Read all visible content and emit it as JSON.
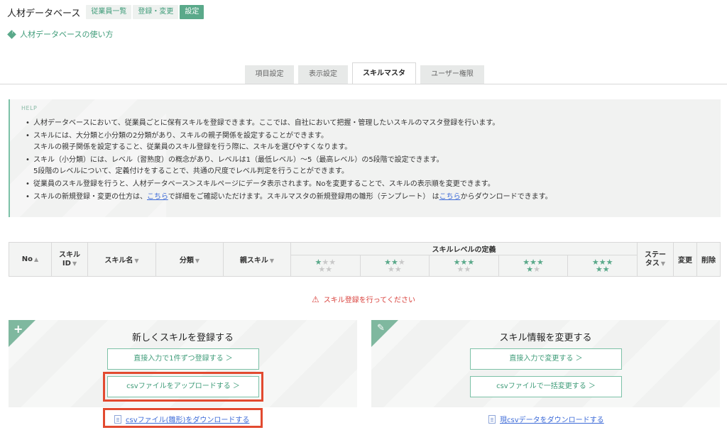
{
  "header": {
    "app_title": "人材データベース",
    "nav": [
      {
        "label": "従業員一覧"
      },
      {
        "label": "登録・変更"
      },
      {
        "label": "設定"
      }
    ]
  },
  "howto_link": "人材データベースの使い方",
  "tabs": [
    {
      "label": "項目設定"
    },
    {
      "label": "表示設定"
    },
    {
      "label": "スキルマスタ"
    },
    {
      "label": "ユーザー権限"
    }
  ],
  "help": {
    "label": "HELP",
    "items": [
      {
        "line1": "人材データベースにおいて、従業員ごとに保有スキルを登録できます。ここでは、自社において把握・管理したいスキルのマスタ登録を行います。"
      },
      {
        "line1": "スキルには、大分類と小分類の2分類があり、スキルの親子関係を設定することができます。",
        "line2": "スキルの親子関係を設定すること、従業員のスキル登録を行う際に、スキルを選びやすくなります。"
      },
      {
        "line1": "スキル（小分類）には、レベル（習熟度）の概念があり、レベルは1（最低レベル）〜5（最高レベル）の5段階で設定できます。",
        "line2": "5段階のレベルについて、定義付けをすることで、共通の尺度でレベル判定を行うことができます。"
      },
      {
        "line1": "従業員のスキル登録を行うと、人材データベース＞スキルページにデータ表示されます。Noを変更することで、スキルの表示順を変更できます。"
      },
      {
        "pre": "スキルの新規登録・変更の仕方は、",
        "link1": "こちら",
        "mid": "で詳細をご確認いただけます。スキルマスタの新規登録用の雛形（テンプレート） は",
        "link2": "こちら",
        "post": "からダウンロードできます。"
      }
    ]
  },
  "table": {
    "col_no": "No",
    "col_skill_id_1": "スキル",
    "col_skill_id_2": "ID",
    "col_skill_name": "スキル名",
    "col_category": "分類",
    "col_parent": "親スキル",
    "col_levels": "スキルレベルの定義",
    "col_status_1": "ステー",
    "col_status_2": "タス",
    "col_edit": "変更",
    "col_delete": "削除",
    "sort_up": "▲",
    "sort_down": "▼",
    "levels": [
      {
        "value": 1,
        "top": "★★★",
        "bottom": "★★"
      },
      {
        "value": 2,
        "top": "★★★",
        "bottom": "★★"
      },
      {
        "value": 3,
        "top": "★★★",
        "bottom": "★★"
      },
      {
        "value": 4,
        "top": "★★★",
        "bottom": "★★"
      },
      {
        "value": 5,
        "top": "★★★",
        "bottom": "★★"
      }
    ]
  },
  "error_message": "スキル登録を行ってください",
  "register_panel": {
    "title": "新しくスキルを登録する",
    "btn_direct": "直接入力で1件ずつ登録する ＞",
    "btn_csv": "csvファイルをアップロードする ＞",
    "download_link": "csvファイル(雛形)をダウンロードする"
  },
  "change_panel": {
    "title": "スキル情報を変更する",
    "btn_direct": "直接入力で変更する ＞",
    "btn_csv": "csvファイルで一括変更する ＞",
    "download_link": "現csvデータをダウンロードする"
  },
  "colors": {
    "accent": "#5aa98a",
    "highlight": "#e24a30",
    "error": "#d9413c",
    "link": "#3d6bd8"
  }
}
